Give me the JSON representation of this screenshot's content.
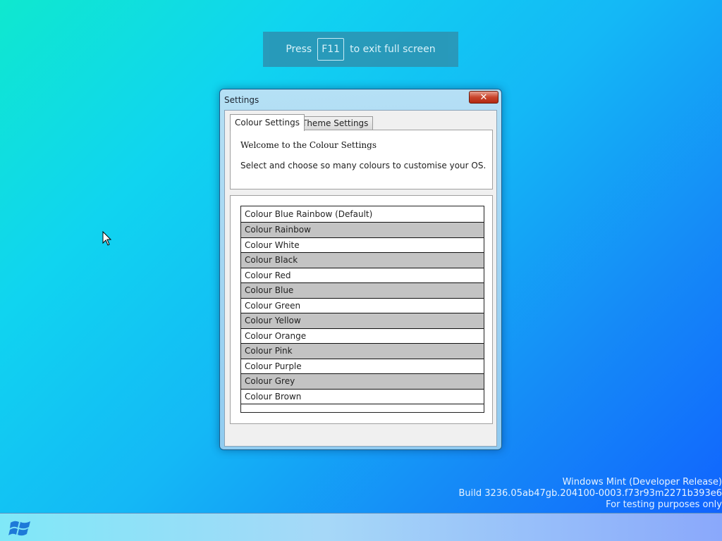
{
  "fullscreen_banner": {
    "press": "Press",
    "key": "F11",
    "suffix": "to exit full screen"
  },
  "window": {
    "title": "Settings",
    "close_glyph": "✕",
    "tabs": [
      {
        "label": "Colour Settings",
        "active": true
      },
      {
        "label": "Theme Settings",
        "active": false
      }
    ],
    "welcome": "Welcome to the Colour Settings",
    "description": "Select and choose so many colours to customise your OS.",
    "colour_options": [
      "Colour Blue Rainbow (Default)",
      "Colour Rainbow",
      "Colour White",
      "Colour Black",
      "Colour Red",
      "Colour Blue",
      "Colour Green",
      "Colour Yellow",
      "Colour Orange",
      "Colour Pink",
      "Colour Purple",
      "Colour Grey",
      "Colour Brown"
    ]
  },
  "watermark": {
    "line1": "Windows Mint (Developer Release)",
    "line2": "Build 3236.05ab47gb.204100-0003.f73r93m2271b393e6",
    "line3": "For testing purposes only"
  },
  "taskbar": {
    "start_icon": "windows-logo-icon"
  },
  "colors": {
    "accent": "#1589f7",
    "close_button": "#c9442c",
    "list_alt_row": "#c3c3c3"
  }
}
